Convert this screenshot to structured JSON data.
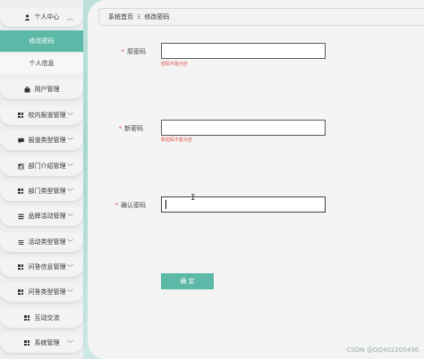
{
  "sidebar": {
    "items": [
      {
        "label": "个人中心",
        "icon": "user-icon",
        "expanded": true
      },
      {
        "label": "修改密码",
        "active": true
      },
      {
        "label": "个人信息"
      },
      {
        "label": "用户管理",
        "icon": "briefcase-icon"
      },
      {
        "label": "校内报道管理",
        "icon": "grid-icon"
      },
      {
        "label": "报道类型管理",
        "icon": "chat-icon"
      },
      {
        "label": "部门介绍管理",
        "icon": "chart-icon"
      },
      {
        "label": "部门类型管理",
        "icon": "grid-icon"
      },
      {
        "label": "品牌活动管理",
        "icon": "list-icon"
      },
      {
        "label": "活动类型管理",
        "icon": "sliders-icon"
      },
      {
        "label": "问答信息管理",
        "icon": "grid-icon"
      },
      {
        "label": "问答类型管理",
        "icon": "grid-icon"
      },
      {
        "label": "互动交流",
        "icon": "grid-icon"
      },
      {
        "label": "系统管理",
        "icon": "grid-icon"
      }
    ]
  },
  "breadcrumb": {
    "home": "系统首页",
    "separator": "Ξ",
    "current": "修改密码"
  },
  "form": {
    "old_password": {
      "label": "原密码",
      "error": "密码不能为空",
      "value": ""
    },
    "new_password": {
      "label": "新密码",
      "error": "新密码不能为空",
      "value": ""
    },
    "confirm_password": {
      "label": "确认密码",
      "value": ""
    },
    "submit_label": "确 定"
  },
  "watermark": "CSDN @QQ402205496",
  "colors": {
    "accent": "#5cb8a7",
    "error": "#e14b4b"
  }
}
